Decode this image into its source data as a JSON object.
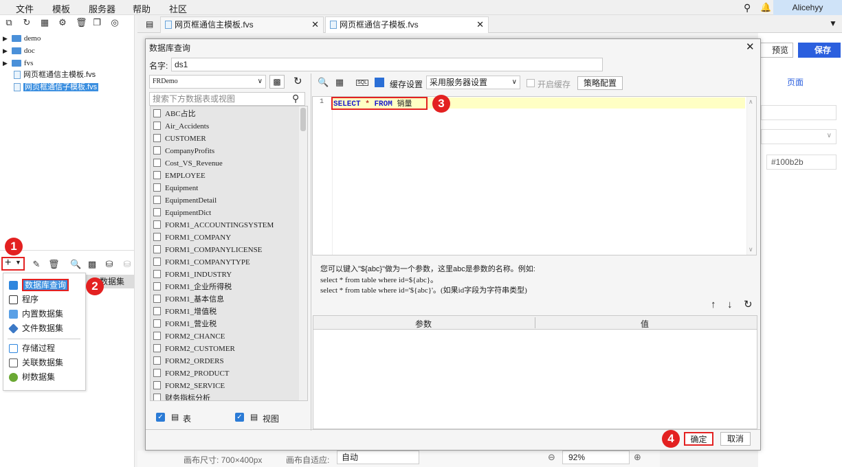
{
  "menubar": {
    "items": [
      "文件",
      "模板",
      "服务器",
      "帮助",
      "社区"
    ],
    "user": "Alicehyy"
  },
  "tree": {
    "items": [
      {
        "label": "demo",
        "type": "folder"
      },
      {
        "label": "doc",
        "type": "folder"
      },
      {
        "label": "fvs",
        "type": "folder"
      },
      {
        "label": "网页框通信主模板.fvs",
        "type": "file"
      },
      {
        "label": "网页框通信子模板.fvs",
        "type": "file",
        "selected": true
      }
    ]
  },
  "tabs": [
    {
      "label": "网页框通信主模板.fvs"
    },
    {
      "label": "网页框通信子模板.fvs",
      "active": true
    }
  ],
  "dataset_label_partial": "数据集",
  "add_menu": {
    "items": [
      "数据库查询",
      "程序",
      "内置数据集",
      "文件数据集",
      "存储过程",
      "关联数据集",
      "树数据集"
    ]
  },
  "badges": [
    "1",
    "2",
    "3",
    "4"
  ],
  "right_panel": {
    "preview": "预览",
    "save": "保存",
    "page_tab": "页面",
    "color_value": "#100b2b"
  },
  "bottom_bar": {
    "canvas_size": "画布尺寸: 700×400px",
    "adapt_label": "画布自适应:",
    "adapt_value": "自动",
    "zoom": "92%"
  },
  "dialog": {
    "title": "数据库查询",
    "name_label": "名字:",
    "name_value": "ds1",
    "connection": "FRDemo",
    "search_placeholder": "搜索下方数据表或视图",
    "tables": [
      "ABC占比",
      "Air_Accidents",
      "CUSTOMER",
      "CompanyProfits",
      "Cost_VS_Revenue",
      "EMPLOYEE",
      "Equipment",
      "EquipmentDetail",
      "EquipmentDict",
      "FORM1_ACCOUNTINGSYSTEM",
      "FORM1_COMPANY",
      "FORM1_COMPANYLICENSE",
      "FORM1_COMPANYTYPE",
      "FORM1_INDUSTRY",
      "FORM1_企业所得税",
      "FORM1_基本信息",
      "FORM1_增值税",
      "FORM1_营业税",
      "FORM2_CHANCE",
      "FORM2_CUSTOMER",
      "FORM2_ORDERS",
      "FORM2_PRODUCT",
      "FORM2_SERVICE",
      "财务指标分析"
    ],
    "show_table": "表",
    "show_view": "视图",
    "cache_label": "缓存设置",
    "cache_value": "采用服务器设置",
    "enable_cache": "开启缓存",
    "strategy": "策略配置",
    "line_no": "1",
    "sql": {
      "kw1": "SELECT",
      "star": "*",
      "kw2": "FROM",
      "table": "销量"
    },
    "hint": [
      "您可以键入\"${abc}\"做为一个参数，这里abc是参数的名称。例如:",
      "select * from table where id=${abc}。",
      "select * from table where id='${abc}'。(如果id字段为字符串类型)"
    ],
    "param_header": "参数",
    "value_header": "值",
    "ok": "确定",
    "cancel": "取消"
  },
  "colors": {
    "accent": "#2b5fde",
    "badge": "#e32121",
    "highlight": "#ffffc4",
    "selection": "#3b8fe0"
  }
}
